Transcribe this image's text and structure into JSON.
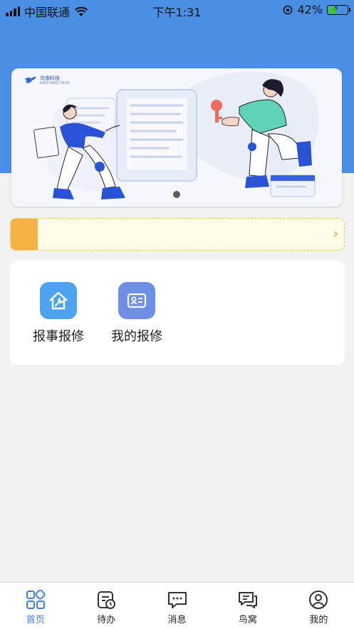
{
  "status_bar": {
    "carrier": "中国联通",
    "time": "下午1:31",
    "battery_percent": "42%",
    "battery_level": 0.42
  },
  "banner": {
    "logo_text": "鸟悄科技",
    "logo_subtext": "NIAO NIAO TECH",
    "active_slide": 1,
    "slide_count": 1
  },
  "notice": {
    "text": ""
  },
  "services": [
    {
      "label": "报事报修",
      "icon": "house-wrench-icon",
      "color": "#4ea3f0"
    },
    {
      "label": "我的报修",
      "icon": "id-card-icon",
      "color": "#6f8fe6"
    }
  ],
  "tabs": [
    {
      "label": "首页",
      "icon": "home-grid-icon",
      "active": true
    },
    {
      "label": "待办",
      "icon": "todo-clock-icon",
      "active": false
    },
    {
      "label": "消息",
      "icon": "message-icon",
      "active": false
    },
    {
      "label": "鸟窝",
      "icon": "chat-bubbles-icon",
      "active": false
    },
    {
      "label": "我的",
      "icon": "user-circle-icon",
      "active": false
    }
  ],
  "colors": {
    "header_blue": "#4a8fe3",
    "accent_blue": "#3c7fe0",
    "notice_orange": "#f5b240"
  }
}
